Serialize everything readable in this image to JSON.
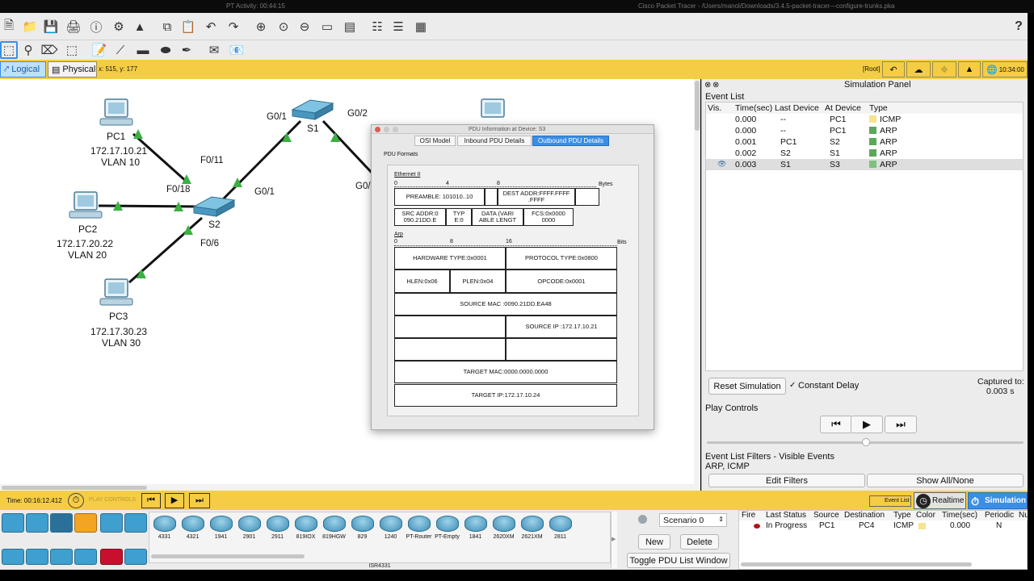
{
  "titlebar": {
    "left": "PT Activity: 00:44:15",
    "center": "Cisco Packet Tracer - /Users/manol/Downloads/3.4.5-packet-tracer---configure-trunks.pka"
  },
  "toolbar": {
    "help": "?",
    "icons1": [
      "new-file-icon",
      "open-folder-icon",
      "save-icon",
      "print-icon",
      "info-icon",
      "wizard-icon",
      "network-icon",
      "copy-icon",
      "paste-icon",
      "undo-icon",
      "redo-icon",
      "zoom-in-icon",
      "zoom-reset-icon",
      "zoom-out-icon",
      "drawing-palette-icon",
      "custom-device-icon",
      "pdu-list-icon",
      "image-icon"
    ],
    "icons2": [
      "select-icon",
      "inspect-icon",
      "delete-icon",
      "resize-icon",
      "note-icon",
      "line-icon",
      "rectangle-icon",
      "ellipse-icon",
      "freeform-icon",
      "add-simple-pdu-icon",
      "add-complex-pdu-icon"
    ]
  },
  "modebar": {
    "logical": "Logical",
    "physical": "Physical",
    "coords": "x: 515, y: 177",
    "root": "[Root]",
    "time": "10:34:00"
  },
  "topology": {
    "pc1": {
      "name": "PC1",
      "ip": "172.17.10.21",
      "vlan": "VLAN 10"
    },
    "pc2": {
      "name": "PC2",
      "ip": "172.17.20.22",
      "vlan": "VLAN 20"
    },
    "pc3": {
      "name": "PC3",
      "ip": "172.17.30.23",
      "vlan": "VLAN 30"
    },
    "s1": "S1",
    "s2": "S2",
    "ports": {
      "s1_g01": "G0/1",
      "s1_g02": "G0/2",
      "s2_f011": "F0/11",
      "s2_f018": "F0/18",
      "s2_g01": "G0/1",
      "s2_f06": "F0/6",
      "g0_partial": "G0/"
    }
  },
  "pdu": {
    "title": "PDU Information at Device: S3",
    "tabs": [
      "OSI Model",
      "Inbound PDU Details",
      "Outbound PDU Details"
    ],
    "active_tab": 2,
    "formats_label": "PDU Formats",
    "ethernet": {
      "label": "Ethernet II",
      "ruler": [
        "0",
        "4",
        "8"
      ],
      "unit": "Bytes",
      "preamble": "PREAMBLE: 101010..10",
      "dest": "DEST ADDR:FFFF.FFFF\n.FFFF",
      "src": "SRC ADDR:0\n090.21DD.E",
      "typ": "TYP\nE:0",
      "data": "DATA (VARI\nABLE LENGT",
      "fcs": "FCS:0x0000\n0000"
    },
    "arp": {
      "label": "Arp",
      "ruler": [
        "0",
        "8",
        "16"
      ],
      "unit": "Bits",
      "hw_type": "HARDWARE TYPE:0x0001",
      "proto_type": "PROTOCOL TYPE:0x0800",
      "hlen": "HLEN:0x06",
      "plen": "PLEN:0x04",
      "opcode": "OPCODE:0x0001",
      "src_mac": "SOURCE MAC :0090.21DD.EA48",
      "src_ip": "SOURCE IP :172.17.10.21",
      "target_mac": "TARGET MAC:0000.0000.0000",
      "target_ip": "TARGET IP:172.17.10.24"
    }
  },
  "sim": {
    "title": "Simulation Panel",
    "event_list_label": "Event List",
    "headers": [
      "Vis.",
      "Time(sec)",
      "Last Device",
      "At Device",
      "Type"
    ],
    "events": [
      {
        "time": "0.000",
        "last": "--",
        "at": "PC1",
        "type": "ICMP",
        "color": "#f6e48e",
        "vis": ""
      },
      {
        "time": "0.000",
        "last": "--",
        "at": "PC1",
        "type": "ARP",
        "color": "#5aa85a",
        "vis": ""
      },
      {
        "time": "0.001",
        "last": "PC1",
        "at": "S2",
        "type": "ARP",
        "color": "#5aa85a",
        "vis": ""
      },
      {
        "time": "0.002",
        "last": "S2",
        "at": "S1",
        "type": "ARP",
        "color": "#5aa85a",
        "vis": ""
      },
      {
        "time": "0.003",
        "last": "S1",
        "at": "S3",
        "type": "ARP",
        "color": "#7fc07f",
        "vis": "eye"
      }
    ],
    "reset": "Reset Simulation",
    "constant_delay": "Constant Delay",
    "captured_label": "Captured to:",
    "captured_value": "0.003 s",
    "play_controls": "Play Controls",
    "filters_label": "Event List Filters - Visible Events",
    "filters_value": "ARP, ICMP",
    "edit_filters": "Edit Filters",
    "show_all": "Show All/None"
  },
  "bottombar": {
    "time": "Time: 00:16:12.412",
    "play_controls": "PLAY CONTROLS",
    "event_list": "Event List",
    "realtime": "Realtime",
    "simulation": "Simulation"
  },
  "devices": {
    "models": [
      "4331",
      "4321",
      "1941",
      "2901",
      "2911",
      "819IOX",
      "819HGW",
      "829",
      "1240",
      "PT-Router",
      "PT-Empty",
      "1841",
      "2620XM",
      "2621XM",
      "2811"
    ],
    "selected": "ISR4331"
  },
  "scenario": {
    "select": "Scenario 0",
    "new": "New",
    "delete": "Delete",
    "toggle": "Toggle PDU List Window"
  },
  "pdulist": {
    "headers": [
      "Fire",
      "Last Status",
      "Source",
      "Destination",
      "Type",
      "Color",
      "Time(sec)",
      "Periodic",
      "Nu"
    ],
    "row": {
      "status": "In Progress",
      "source": "PC1",
      "dest": "PC4",
      "type": "ICMP",
      "time": "0.000",
      "periodic": "N"
    }
  },
  "colors": {
    "accent": "#f5cd44",
    "link": "#111111",
    "port_up": "#3cb043",
    "active_tab": "#3a8ee6"
  }
}
